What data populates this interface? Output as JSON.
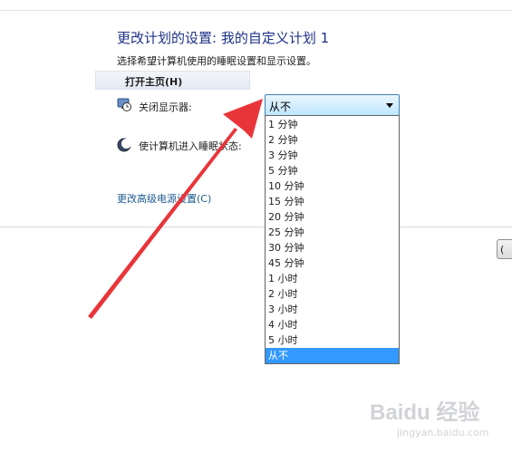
{
  "header": {
    "title": "更改计划的设置: 我的自定义计划 1",
    "subtitle": "选择希望计算机使用的睡眠设置和显示设置。"
  },
  "home_button": {
    "label": "打开主页(H)"
  },
  "settings": {
    "display_off": {
      "label": "关闭显示器:",
      "value": "从不",
      "icon": "monitor-clock-icon"
    },
    "sleep": {
      "label": "使计算机进入睡眠状态:",
      "icon": "moon-icon"
    }
  },
  "dropdown": {
    "options": [
      "1 分钟",
      "2 分钟",
      "3 分钟",
      "5 分钟",
      "10 分钟",
      "15 分钟",
      "20 分钟",
      "25 分钟",
      "30 分钟",
      "45 分钟",
      "1 小时",
      "2 小时",
      "3 小时",
      "4 小时",
      "5 小时",
      "从不"
    ],
    "selected": "从不",
    "highlight_color": "#3399ff"
  },
  "advanced_link": {
    "label": "更改高级电源设置(C)"
  },
  "annotation": {
    "arrow_color": "#e8353a"
  },
  "watermark": {
    "logo": "Baidu 经验",
    "url": "jingyan.baidu.com"
  }
}
